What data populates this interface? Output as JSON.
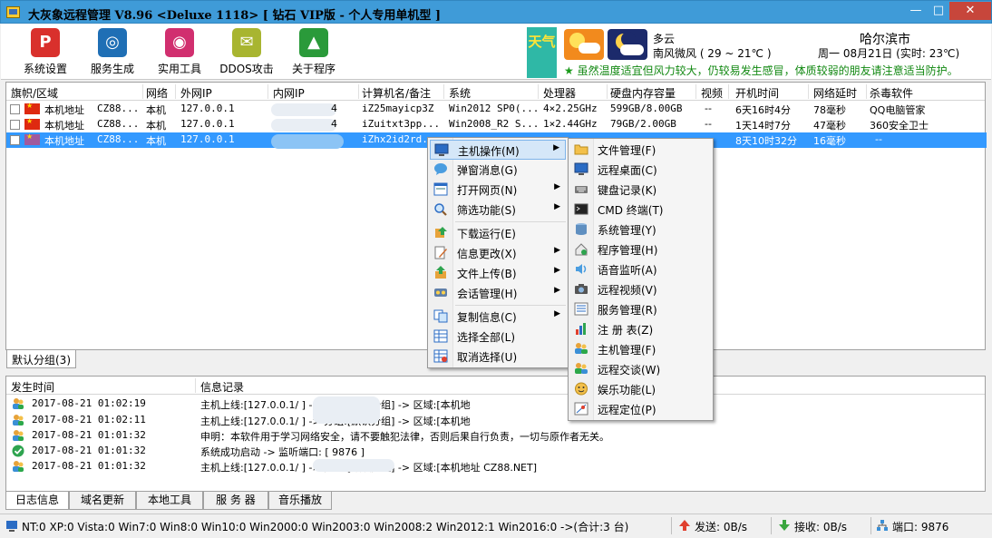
{
  "window": {
    "title": "大灰象远程管理 V8.96 <Deluxe 1118> [ 钻石 VIP版 - 个人专用单机型 ]",
    "controls": {
      "minimize": "—",
      "maximize": "□",
      "close": "✕"
    }
  },
  "toolbar": {
    "items": [
      {
        "label": "系统设置",
        "icon": "gear-icon",
        "color": "#d9302c",
        "glyph": "P"
      },
      {
        "label": "服务生成",
        "icon": "service-icon",
        "color": "#1f6fb5",
        "glyph": "◎"
      },
      {
        "label": "实用工具",
        "icon": "tools-icon",
        "color": "#d12f6f",
        "glyph": "◉"
      },
      {
        "label": "DDOS攻击",
        "icon": "ddos-icon",
        "color": "#a8b530",
        "glyph": "✉"
      },
      {
        "label": "关于程序",
        "icon": "about-icon",
        "color": "#2a9a3a",
        "glyph": "▲"
      }
    ]
  },
  "weather": {
    "tag": "天气",
    "condition": "多云",
    "wind_temp": "南风微风 ( 29 ~ 21℃ )",
    "city": "哈尔滨市",
    "date_line": "周一 08月21日 (实时: 23℃)",
    "tip": "虽然温度适宜但风力较大，仍较易发生感冒，体质较弱的朋友请注意适当防护。"
  },
  "table": {
    "columns": [
      "旗帜/区域",
      "网络",
      "外网IP",
      "内网IP",
      "计算机名/备注",
      "系统",
      "处理器",
      "硬盘内存容量",
      "视频",
      "开机时间",
      "网络延时",
      "杀毒软件"
    ],
    "rows": [
      {
        "region": "本机地址",
        "region_note": "CZ88...",
        "network": "本机",
        "wan_ip": "127.0.0.1",
        "lan_ip": "4",
        "computer": "iZ25mayicp3Z",
        "os": "Win2012 SP0(...",
        "cpu": "4×2.25GHz",
        "disk_mem": "599GB/8.00GB",
        "video": "--",
        "uptime": "6天16时4分",
        "latency": "78毫秒",
        "antivirus": "QQ电脑管家",
        "selected": false
      },
      {
        "region": "本机地址",
        "region_note": "CZ88...",
        "network": "本机",
        "wan_ip": "127.0.0.1",
        "lan_ip": "4",
        "computer": "iZuitxt3pp...",
        "os": "Win2008_R2 S...",
        "cpu": "1×2.44GHz",
        "disk_mem": "79GB/2.00GB",
        "video": "--",
        "uptime": "1天14时7分",
        "latency": "47毫秒",
        "antivirus": "360安全卫士",
        "selected": false
      },
      {
        "region": "本机地址",
        "region_note": "CZ88...",
        "network": "本机",
        "wan_ip": "127.0.0.1",
        "lan_ip": "",
        "computer": "iZhx2id2rd...",
        "os": "",
        "cpu": "",
        "disk_mem": "",
        "video": "",
        "uptime": "8天10时32分",
        "latency": "16毫秒",
        "antivirus": "--",
        "selected": true
      }
    ]
  },
  "group_tab": "默认分组(3)",
  "log": {
    "columns": [
      "发生时间",
      "信息记录"
    ],
    "rows": [
      {
        "icon": "user-online-icon",
        "time": "2017-08-21 01:02:19",
        "msg": "主机上线:[127.0.0.1/               ] -> 分组:[默认分组] -> 区域:[本机地"
      },
      {
        "icon": "user-online-icon",
        "time": "2017-08-21 01:02:11",
        "msg": "主机上线:[127.0.0.1/               ] -> 分组:[默认分组] -> 区域:[本机地"
      },
      {
        "icon": "info-icon",
        "time": "2017-08-21 01:01:32",
        "msg": "申明：本软件用于学习网络安全，请不要触犯法律，否则后果自行负责，一切与原作者无关。"
      },
      {
        "icon": "check-icon",
        "time": "2017-08-21 01:01:32",
        "msg": "系统成功启动 -> 监听端口: [ 9876 ]"
      },
      {
        "icon": "user-online-icon",
        "time": "2017-08-21 01:01:32",
        "msg": "主机上线:[127.0.0.1/               ] -> 分组:[默认分组] -> 区域:[本机地址  CZ88.NET]"
      }
    ]
  },
  "bottom_tabs": [
    "日志信息",
    "域名更新",
    "本地工具",
    "服 务 器",
    "音乐播放"
  ],
  "status": {
    "os_counts": "NT:0 XP:0 Vista:0 Win7:0 Win8:0 Win10:0 Win2000:0 Win2003:0 Win2008:2 Win2012:1 Win2016:0 ->(合计:3 台)",
    "send": "发送: 0B/s",
    "recv": "接收: 0B/s",
    "port": "端口: 9876"
  },
  "context_menu": {
    "items": [
      {
        "label": "主机操作(M)",
        "icon": "monitor-icon",
        "submenu": true,
        "highlighted": true
      },
      {
        "label": "弹窗消息(G)",
        "icon": "message-icon",
        "submenu": false
      },
      {
        "label": "打开网页(N)",
        "icon": "webpage-icon",
        "submenu": true
      },
      {
        "label": "筛选功能(S)",
        "icon": "filter-icon",
        "submenu": true
      },
      {
        "label": "下载运行(E)",
        "icon": "download-icon",
        "submenu": false
      },
      {
        "label": "信息更改(X)",
        "icon": "edit-icon",
        "submenu": true
      },
      {
        "label": "文件上传(B)",
        "icon": "upload-icon",
        "submenu": true
      },
      {
        "label": "会话管理(H)",
        "icon": "session-icon",
        "submenu": true
      },
      {
        "label": "复制信息(C)",
        "icon": "copy-icon",
        "submenu": true
      },
      {
        "label": "选择全部(L)",
        "icon": "select-all-icon",
        "submenu": false
      },
      {
        "label": "取消选择(U)",
        "icon": "deselect-icon",
        "submenu": false
      }
    ]
  },
  "submenu": {
    "items": [
      {
        "label": "文件管理(F)",
        "icon": "folder-icon"
      },
      {
        "label": "远程桌面(C)",
        "icon": "desktop-icon"
      },
      {
        "label": "键盘记录(K)",
        "icon": "keyboard-icon"
      },
      {
        "label": "CMD 终端(T)",
        "icon": "terminal-icon"
      },
      {
        "label": "系统管理(Y)",
        "icon": "system-icon"
      },
      {
        "label": "程序管理(H)",
        "icon": "program-icon"
      },
      {
        "label": "语音监听(A)",
        "icon": "audio-icon"
      },
      {
        "label": "远程视频(V)",
        "icon": "camera-icon"
      },
      {
        "label": "服务管理(R)",
        "icon": "service-manage-icon"
      },
      {
        "label": "注 册 表(Z)",
        "icon": "registry-icon"
      },
      {
        "label": "主机管理(F)",
        "icon": "host-manage-icon"
      },
      {
        "label": "远程交谈(W)",
        "icon": "chat-icon"
      },
      {
        "label": "娱乐功能(L)",
        "icon": "fun-icon"
      },
      {
        "label": "远程定位(P)",
        "icon": "location-icon"
      }
    ]
  }
}
